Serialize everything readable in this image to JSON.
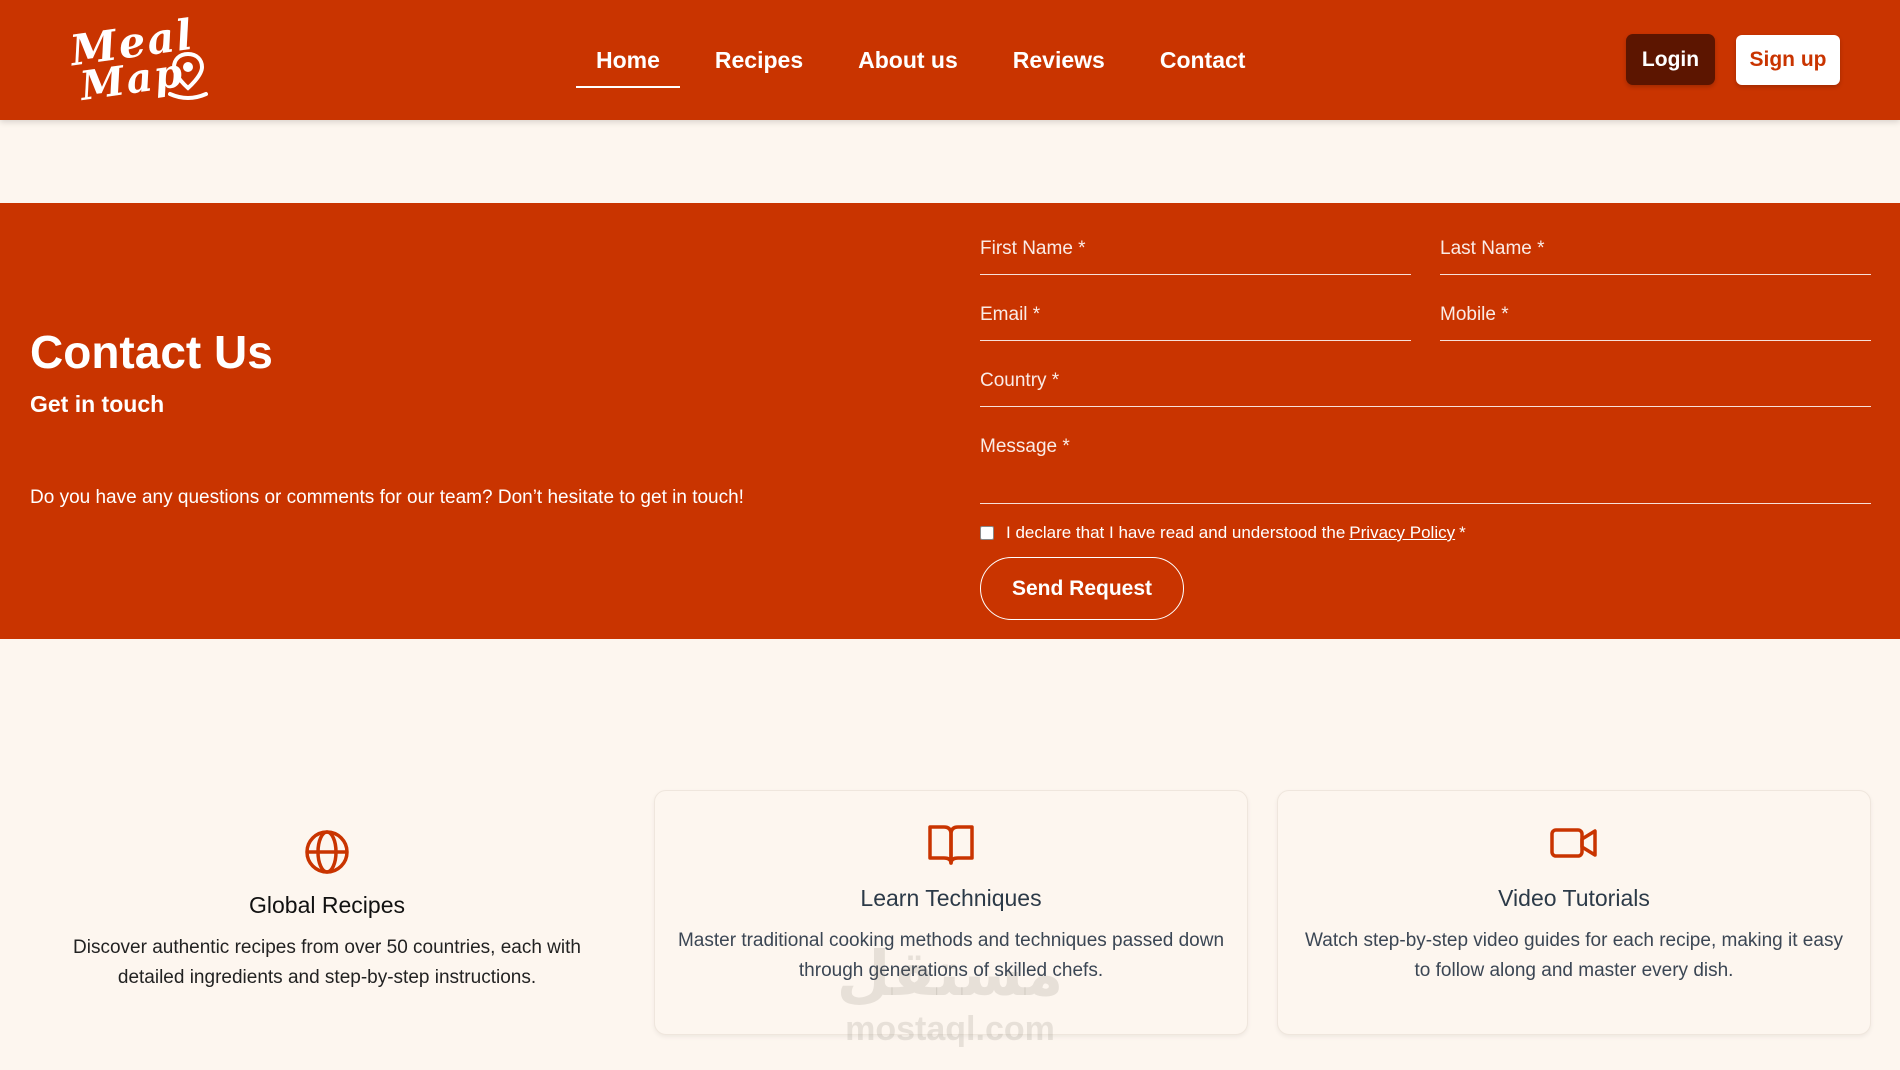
{
  "brand": {
    "logo_line1": "Meal",
    "logo_line2": "Map",
    "color": "#c93400",
    "dark_color": "#5c1500",
    "background": "#fdf6ef"
  },
  "nav": {
    "items": [
      {
        "label": "Home",
        "active": true
      },
      {
        "label": "Recipes",
        "active": false
      },
      {
        "label": "About us",
        "active": false
      },
      {
        "label": "Reviews",
        "active": false
      },
      {
        "label": "Contact",
        "active": false
      }
    ],
    "login_label": "Login",
    "signup_label": "Sign up"
  },
  "contact": {
    "title": "Contact Us",
    "subtitle": "Get in touch",
    "description": "Do you have any questions or comments for our team? Don’t hesitate to get in touch!",
    "fields": {
      "first_name": "First Name *",
      "last_name": "Last Name *",
      "email": "Email *",
      "mobile": "Mobile *",
      "country": "Country *",
      "message": "Message *"
    },
    "declare_text": "I declare that I have read and understood the",
    "privacy_link": "Privacy Policy",
    "required_mark": "*",
    "send_label": "Send Request"
  },
  "features": [
    {
      "icon": "globe-icon",
      "title": "Global Recipes",
      "text": "Discover authentic recipes from over 50 countries, each with detailed ingredients and step-by-step instructions."
    },
    {
      "icon": "book-icon",
      "title": "Learn Techniques",
      "text": "Master traditional cooking methods and techniques passed down through generations of skilled chefs."
    },
    {
      "icon": "video-camera-icon",
      "title": "Video Tutorials",
      "text": "Watch step-by-step video guides for each recipe, making it easy to follow along and master every dish."
    }
  ],
  "watermark": {
    "arabic": "مستقل",
    "latin": "mostaql.com"
  }
}
